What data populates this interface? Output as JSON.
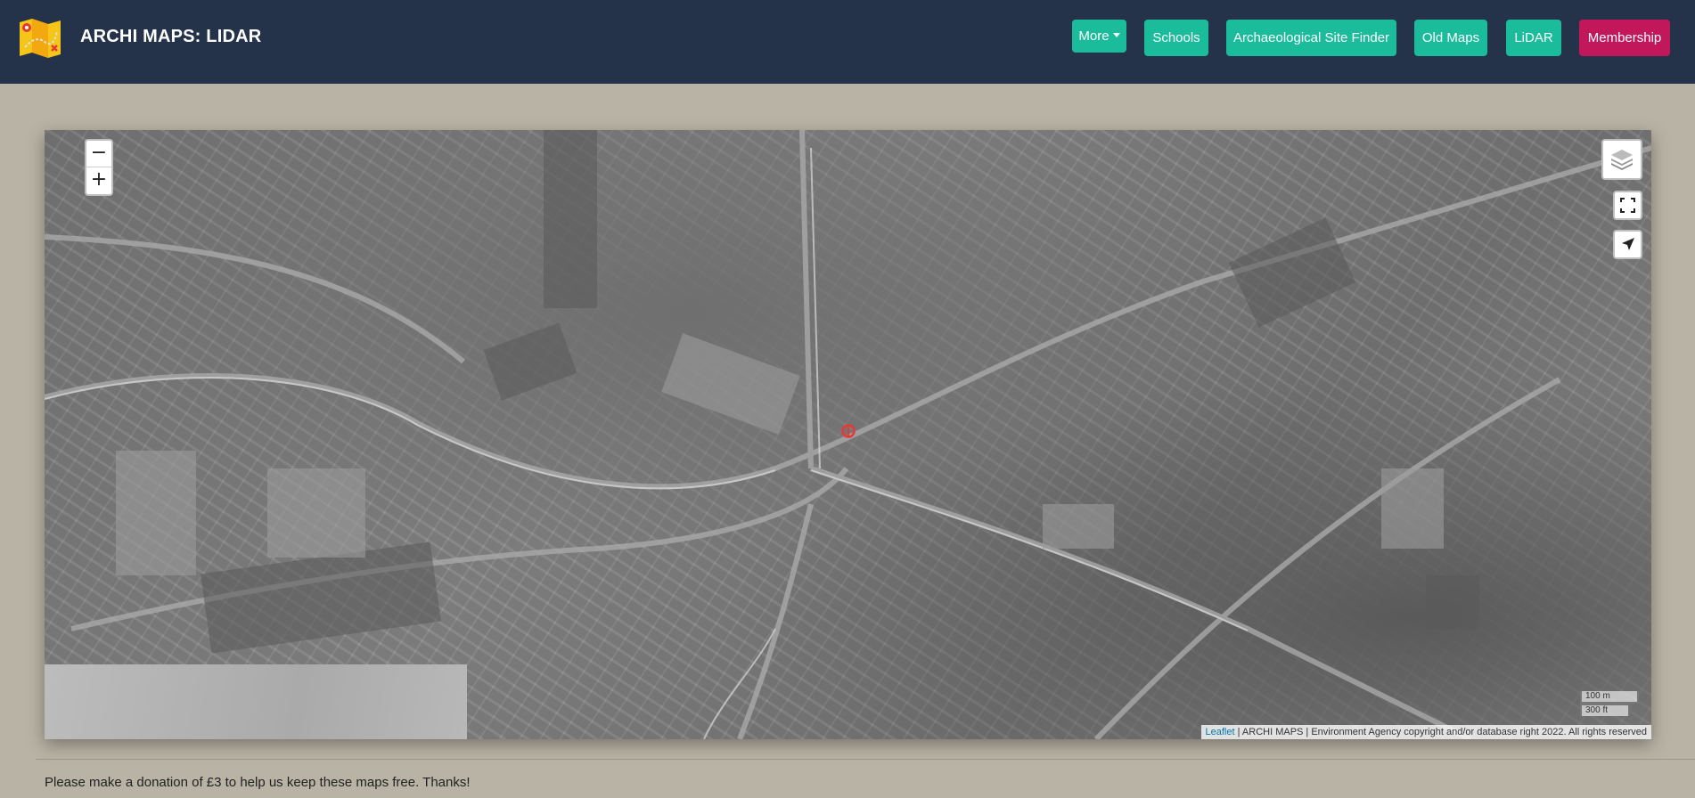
{
  "navbar": {
    "title": "ARCHI MAPS: LIDAR",
    "logo_icon": "folded-map-icon",
    "buttons": {
      "more": "More",
      "schools": "Schools",
      "site_finder": "Archaeological Site Finder",
      "old_maps": "Old Maps",
      "lidar": "LiDAR",
      "membership": "Membership"
    },
    "colors": {
      "background": "#24334a",
      "button": "#1abc9c",
      "membership": "#c2185b"
    }
  },
  "map": {
    "zoom_in": "+",
    "zoom_out": "−",
    "controls": [
      "layers-icon",
      "fullscreen-icon",
      "locate-arrow-icon"
    ],
    "scale": {
      "metric": "100 m",
      "imperial": "300 ft"
    },
    "attribution": {
      "link": "Leaflet",
      "text": " | ARCHI MAPS | Environment Agency copyright and/or database right 2022. All rights reserved"
    },
    "marker_color": "#e53935"
  },
  "footer": {
    "donation_text": "Please make a donation of £3 to help us keep these maps free. Thanks!"
  }
}
